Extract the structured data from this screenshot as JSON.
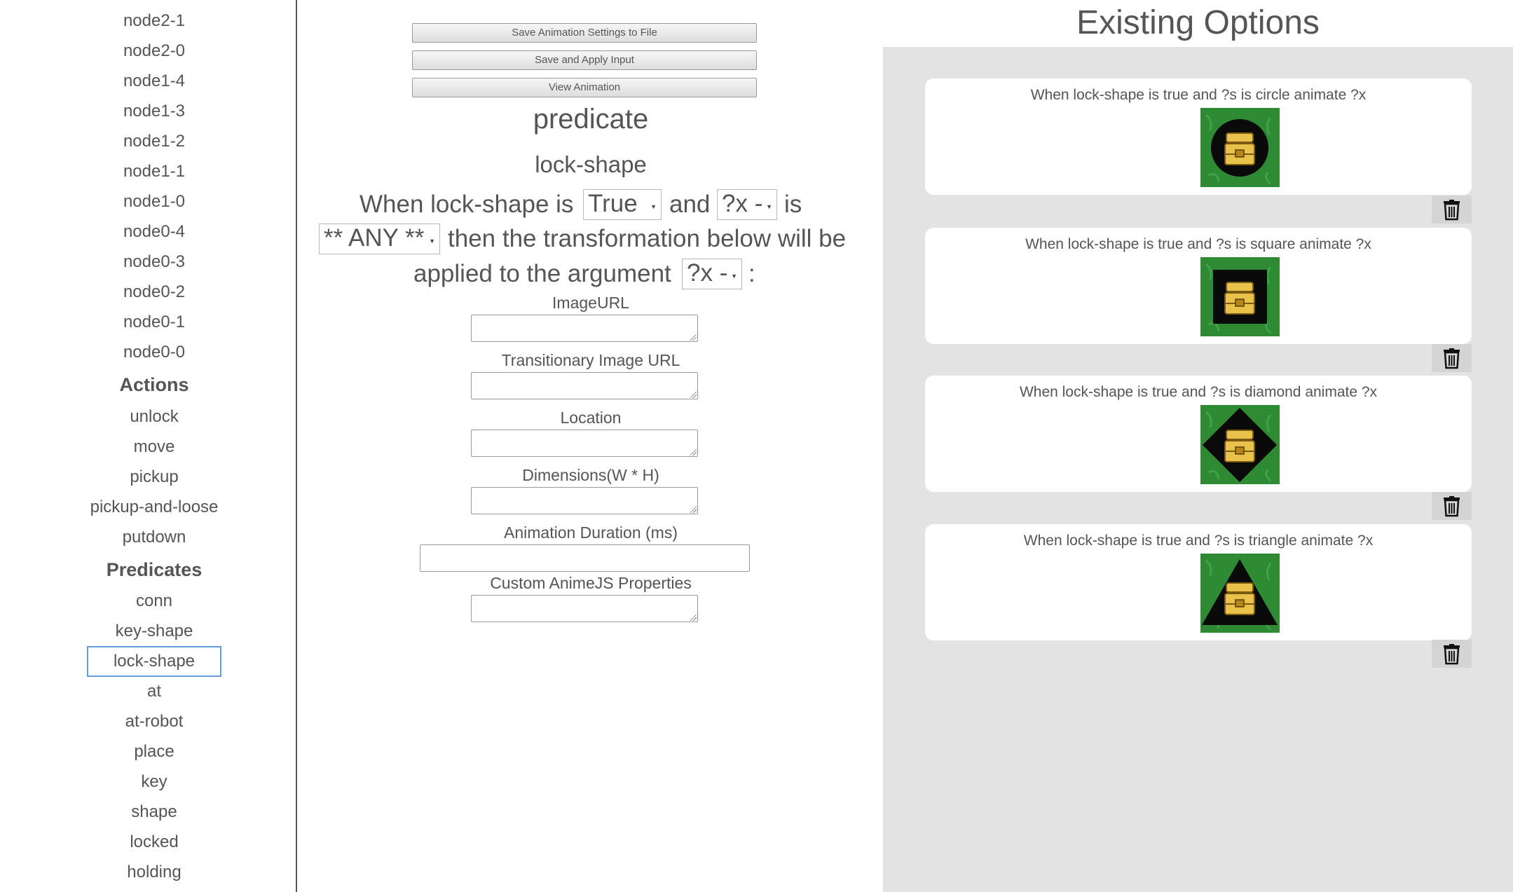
{
  "sidebar": {
    "nodes": [
      "node2-1",
      "node2-0",
      "node1-4",
      "node1-3",
      "node1-2",
      "node1-1",
      "node1-0",
      "node0-4",
      "node0-3",
      "node0-2",
      "node0-1",
      "node0-0"
    ],
    "actions_heading": "Actions",
    "actions": [
      "unlock",
      "move",
      "pickup",
      "pickup-and-loose",
      "putdown"
    ],
    "predicates_heading": "Predicates",
    "predicates": [
      "conn",
      "key-shape",
      "lock-shape",
      "at",
      "at-robot",
      "place",
      "key",
      "shape",
      "locked",
      "holding"
    ],
    "selected": "lock-shape"
  },
  "form": {
    "buttons": {
      "save_settings": "Save Animation Settings to File",
      "save_apply": "Save and Apply Input",
      "view_animation": "View Animation"
    },
    "type_title": "predicate",
    "predicate_name": "lock-shape",
    "sentence": {
      "part1": "When lock-shape is",
      "truth_select": "True",
      "part2": "and",
      "arg_select": "?x -",
      "part3": "is",
      "object_select": "** ANY **",
      "part4": "then the transformation below will be",
      "part5": "applied to the argument",
      "target_select": "?x -",
      "part6": ":"
    },
    "fields": {
      "image_url": "ImageURL",
      "transitional_url": "Transitionary Image URL",
      "location": "Location",
      "dimensions": "Dimensions(W * H)",
      "duration": "Animation Duration (ms)",
      "custom": "Custom AnimeJS Properties"
    }
  },
  "options": {
    "header": "Existing Options",
    "items": [
      {
        "caption": "When lock-shape is true and ?s is circle animate ?x",
        "shape": "circle"
      },
      {
        "caption": "When lock-shape is true and ?s is square animate ?x",
        "shape": "square"
      },
      {
        "caption": "When lock-shape is true and ?s is diamond animate ?x",
        "shape": "diamond"
      },
      {
        "caption": "When lock-shape is true and ?s is triangle animate ?x",
        "shape": "triangle"
      }
    ]
  },
  "colors": {
    "text": "#555555",
    "panel_bg": "#e3e3e3",
    "thumb_bg": "#2e8b34",
    "selected_border": "#6a9bdc",
    "chest": "#e8c24a"
  },
  "icons": {
    "delete": "trash-icon",
    "thumbnail": "lock-chest-icon"
  }
}
